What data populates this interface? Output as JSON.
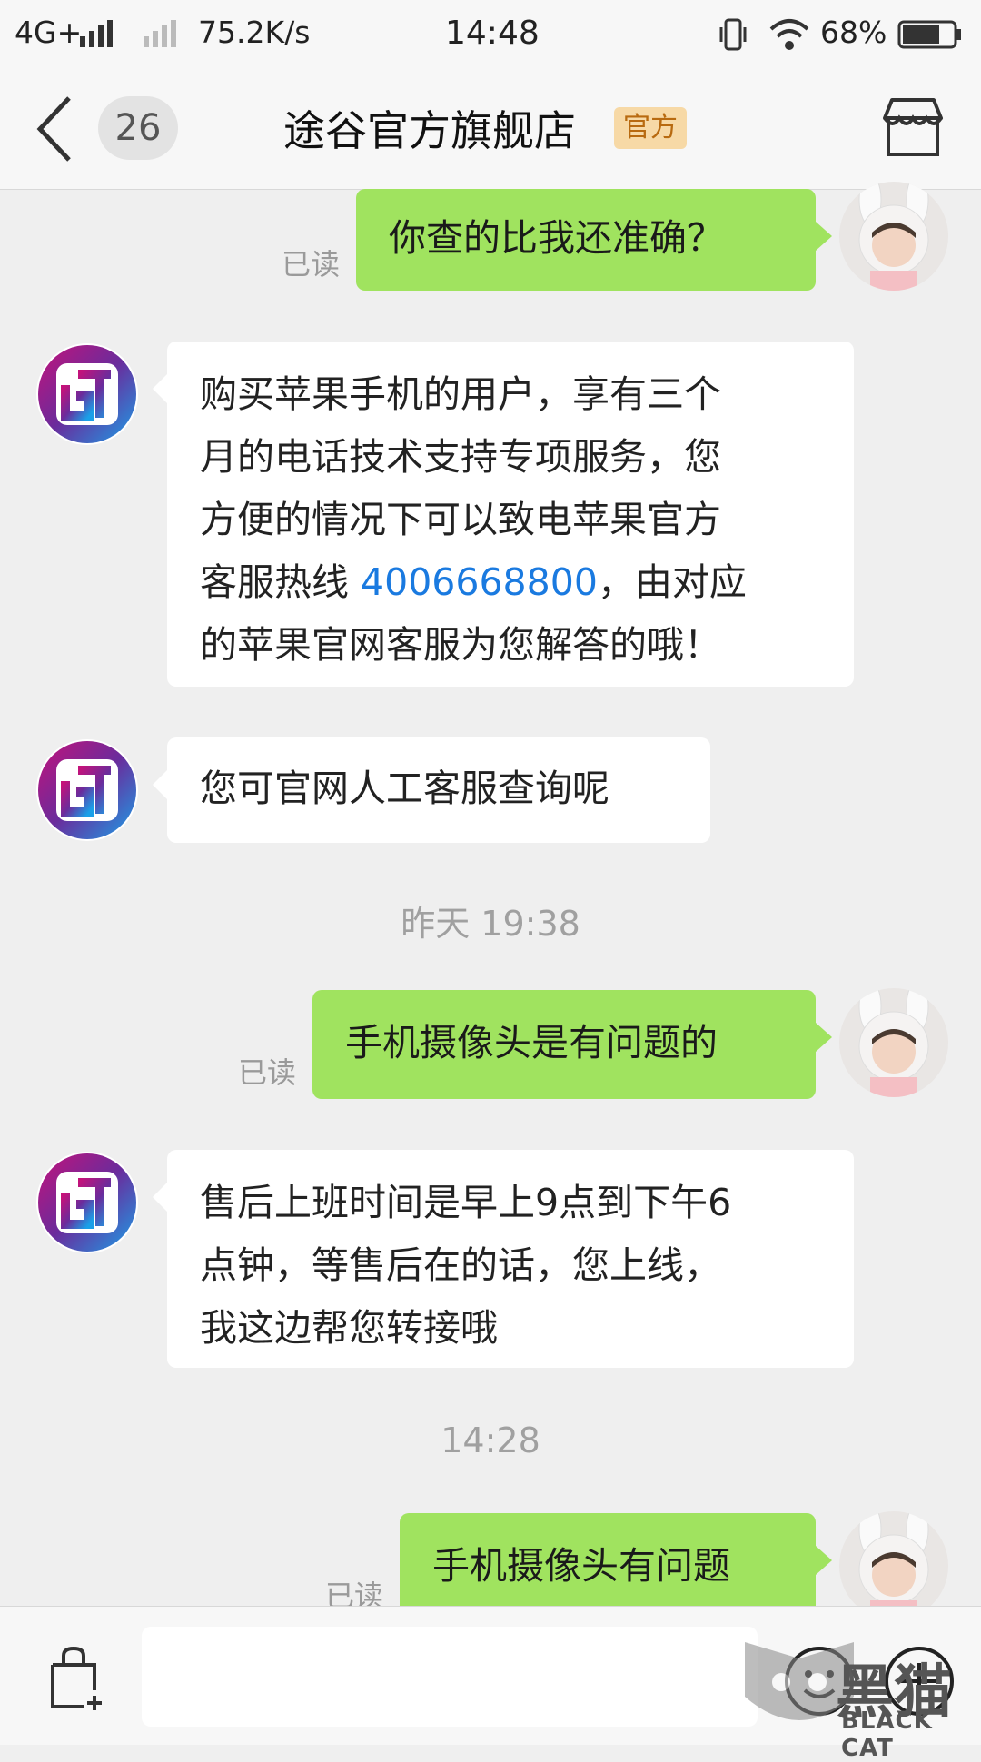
{
  "status_bar": {
    "network": "4G+",
    "speed": "75.2K/s",
    "time": "14:48",
    "battery": "68%"
  },
  "header": {
    "unread_count": "26",
    "shop_name": "途谷官方旗舰店",
    "official_badge": "官方"
  },
  "messages": [
    {
      "dir": "out",
      "text": "你查的比我还准确？",
      "read": "已读"
    },
    {
      "dir": "in",
      "lines": [
        "购买苹果手机的用户，享有三个",
        "月的电话技术支持专项服务，您",
        "方便的情况下可以致电苹果官方"
      ],
      "line4_prefix": "客服热线 ",
      "phone": "4006668800",
      "line4_suffix": "，由对应",
      "line5": "的苹果官网客服为您解答的哦！"
    },
    {
      "dir": "in",
      "text": "您可官网人工客服查询呢"
    },
    {
      "timestamp": "昨天 19:38"
    },
    {
      "dir": "out",
      "text": "手机摄像头是有问题的",
      "read": "已读"
    },
    {
      "dir": "in",
      "lines": [
        "售后上班时间是早上9点到下午6",
        "点钟，等售后在的话，您上线，",
        "我这边帮您转接哦"
      ]
    },
    {
      "timestamp": "14:28"
    },
    {
      "dir": "out",
      "text": "手机摄像头有问题",
      "read": "已读"
    }
  ],
  "input": {
    "placeholder": ""
  },
  "watermark": {
    "cn": "黑猫",
    "en": "BLACK CAT"
  },
  "colors": {
    "outgoing_bubble": "#a0e35f",
    "incoming_bubble": "#ffffff",
    "link": "#1a7ae0",
    "official_badge_bg": "#f7d9a6",
    "official_badge_text": "#b86a10"
  },
  "icons": [
    "back-icon",
    "store-icon",
    "shopping-bag-icon",
    "emoji-icon",
    "plus-icon"
  ]
}
